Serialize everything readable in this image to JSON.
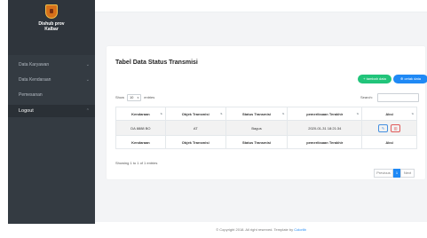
{
  "sidebar": {
    "brand_line1": "Dishub prov",
    "brand_line2": "Kalbar",
    "items": [
      {
        "label": "Data Karyawan"
      },
      {
        "label": "Data Kendaraan"
      },
      {
        "label": "Pemesanan"
      },
      {
        "label": "Logout"
      }
    ]
  },
  "card": {
    "title": "Tabel Data Status Transmisi",
    "btn_add": "+ tambah data",
    "btn_view": "⊕ cetak data",
    "show_prefix": "Show",
    "show_value": "10",
    "show_suffix": "entries",
    "search_label": "Search:",
    "search_value": "",
    "columns": [
      "Kendaraan",
      "Objek Transmisi",
      "Status Transmisi",
      "pemeriksaan Terakhir",
      "Aksi"
    ],
    "rows": [
      [
        "DA 8888 BO",
        "AT",
        "Bagus",
        "2020-01-31 18:21:34"
      ]
    ],
    "showing": "Showing 1 to 1 of 1 entries",
    "pagination": {
      "prev": "Previous",
      "current": "1",
      "next": "Next"
    }
  },
  "footer": {
    "text": "© Copyright 2018. All right reserved. Template by ",
    "link": "Colorlib"
  },
  "colors": {
    "accent_green": "#21c47a",
    "accent_blue": "#1f89f5",
    "sidebar": "#343b42"
  }
}
